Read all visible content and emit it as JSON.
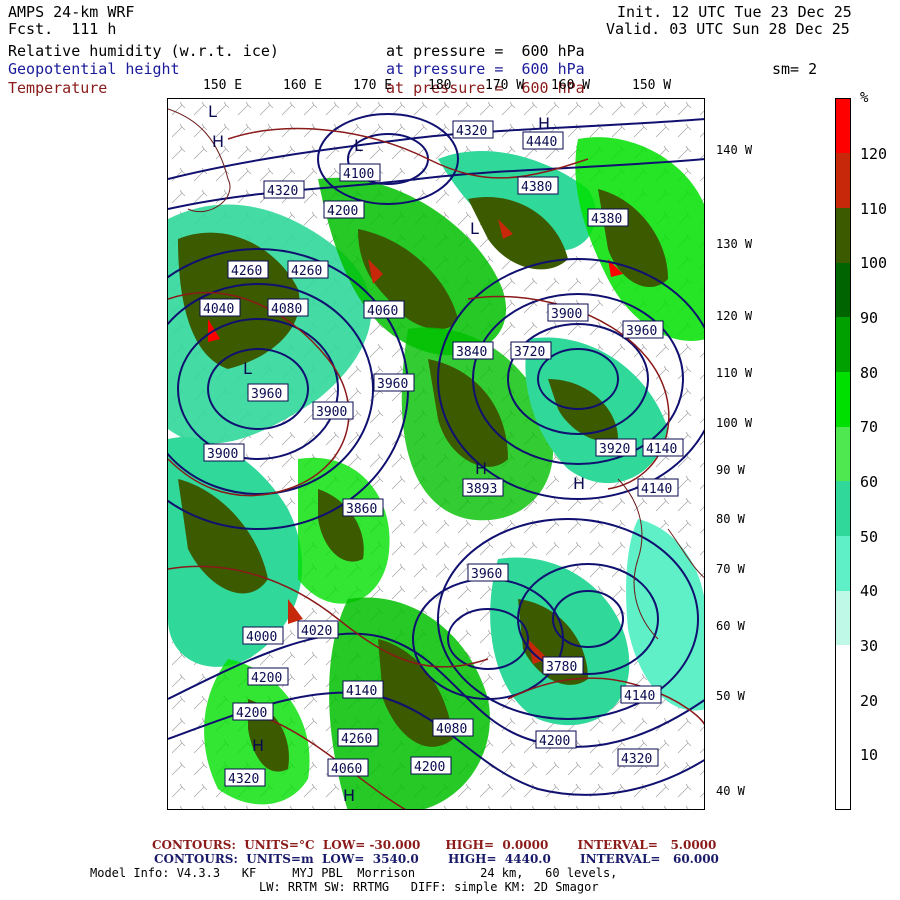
{
  "header": {
    "model": "AMPS 24-km WRF",
    "fcst": "Fcst.  111 h",
    "init": "Init. 12 UTC Tue 23 Dec 25",
    "valid": "Valid. 03 UTC Sun 28 Dec 25",
    "line1_label": "Relative humidity (w.r.t. ice)",
    "line1_level": "at pressure =  600 hPa",
    "line2_label": "Geopotential height",
    "line2_level": "at pressure =  600 hPa",
    "line3_label": "Temperature",
    "line3_level": "at pressure =  600 hPa",
    "smoothing": "sm= 2"
  },
  "top_labels": [
    "150 E",
    "160 E",
    "170 E",
    "180",
    "170 W",
    "160 W",
    "150 W"
  ],
  "right_labels": [
    "140 W",
    "130 W",
    "120 W",
    "110 W",
    "100 W",
    "90 W",
    "80 W",
    "70 W",
    "60 W",
    "50 W",
    "40 W"
  ],
  "colorbar": {
    "unit": "%",
    "labels": [
      "120",
      "110",
      "100",
      "90",
      "80",
      "70",
      "60",
      "50",
      "40",
      "30",
      "20",
      "10"
    ],
    "colors": [
      "#ff0000",
      "#c8280a",
      "#3c5a00",
      "#006400",
      "#00a000",
      "#00e000",
      "#50e850",
      "#30d89a",
      "#60f0c8",
      "#c0f8e8",
      "#ffffff",
      "#ffffff",
      "#ffffff"
    ]
  },
  "map_labels": {
    "heights": [
      "4320",
      "4200",
      "4100",
      "4080",
      "4040",
      "4260",
      "4260",
      "3900",
      "3960",
      "4060",
      "3960",
      "3840",
      "3720",
      "3900",
      "3900",
      "3960",
      "4140",
      "4140",
      "3920",
      "3860",
      "3893",
      "3960",
      "4020",
      "4000",
      "4200",
      "4200",
      "4140",
      "4260",
      "4200",
      "4320",
      "4440",
      "4380",
      "4320",
      "4080",
      "3780",
      "4140",
      "4200",
      "4320",
      "4060",
      "4380"
    ],
    "h_markers": [
      "H",
      "H",
      "H",
      "H",
      "H",
      "H"
    ],
    "l_markers": [
      "L",
      "L",
      "L",
      "L"
    ]
  },
  "footer": {
    "contours1": "CONTOURS:  UNITS=°C  LOW= -30.000      HIGH=  0.0000       INTERVAL=   5.0000",
    "contours2": "CONTOURS:  UNITS=m  LOW=  3540.0       HIGH=  4440.0       INTERVAL=   60.000",
    "model_info": "Model Info: V4.3.3   KF     MYJ PBL  Morrison         24 km,   60 levels,",
    "physics": "LW: RRTM SW: RRTMG   DIFF: simple KM: 2D Smagor"
  },
  "colors": {
    "contour_blue": "#101070",
    "contour_red": "#8b1a1a",
    "coast": "#6b1a1a"
  }
}
